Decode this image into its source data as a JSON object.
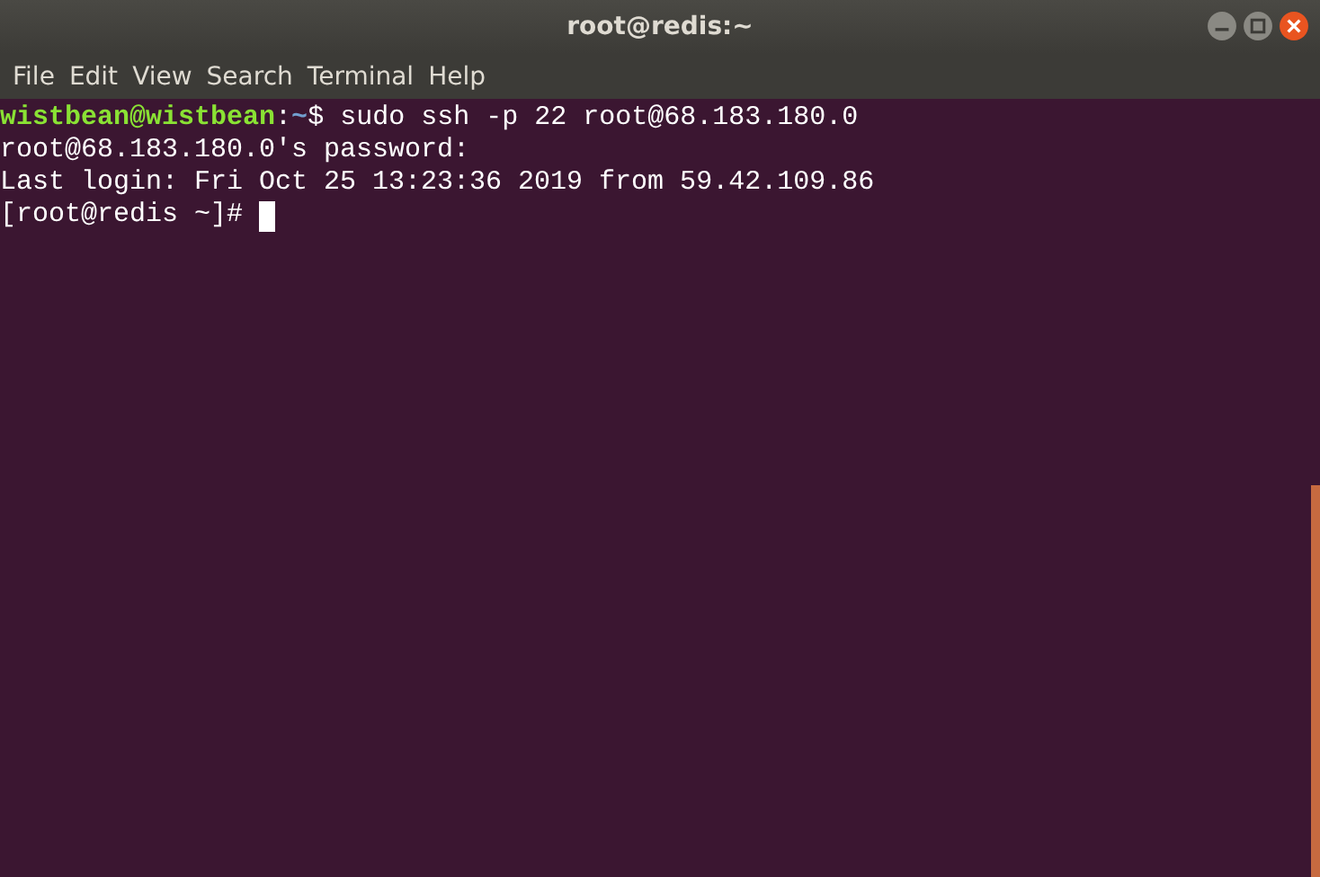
{
  "window": {
    "title": "root@redis:~"
  },
  "menu": [
    "File",
    "Edit",
    "View",
    "Search",
    "Terminal",
    "Help"
  ],
  "terminal": {
    "lines": [
      {
        "kind": "prompt",
        "user": "wistbean@wistbean",
        "separator": ":",
        "path": "~",
        "command": "$ sudo ssh -p 22 root@68.183.180.0"
      },
      {
        "kind": "output",
        "text": "root@68.183.180.0's password:"
      },
      {
        "kind": "output",
        "text": "Last login: Fri Oct 25 13:23:36 2019 from 59.42.109.86"
      },
      {
        "kind": "output",
        "text": "[root@redis ~]#",
        "cursor": true
      }
    ]
  }
}
